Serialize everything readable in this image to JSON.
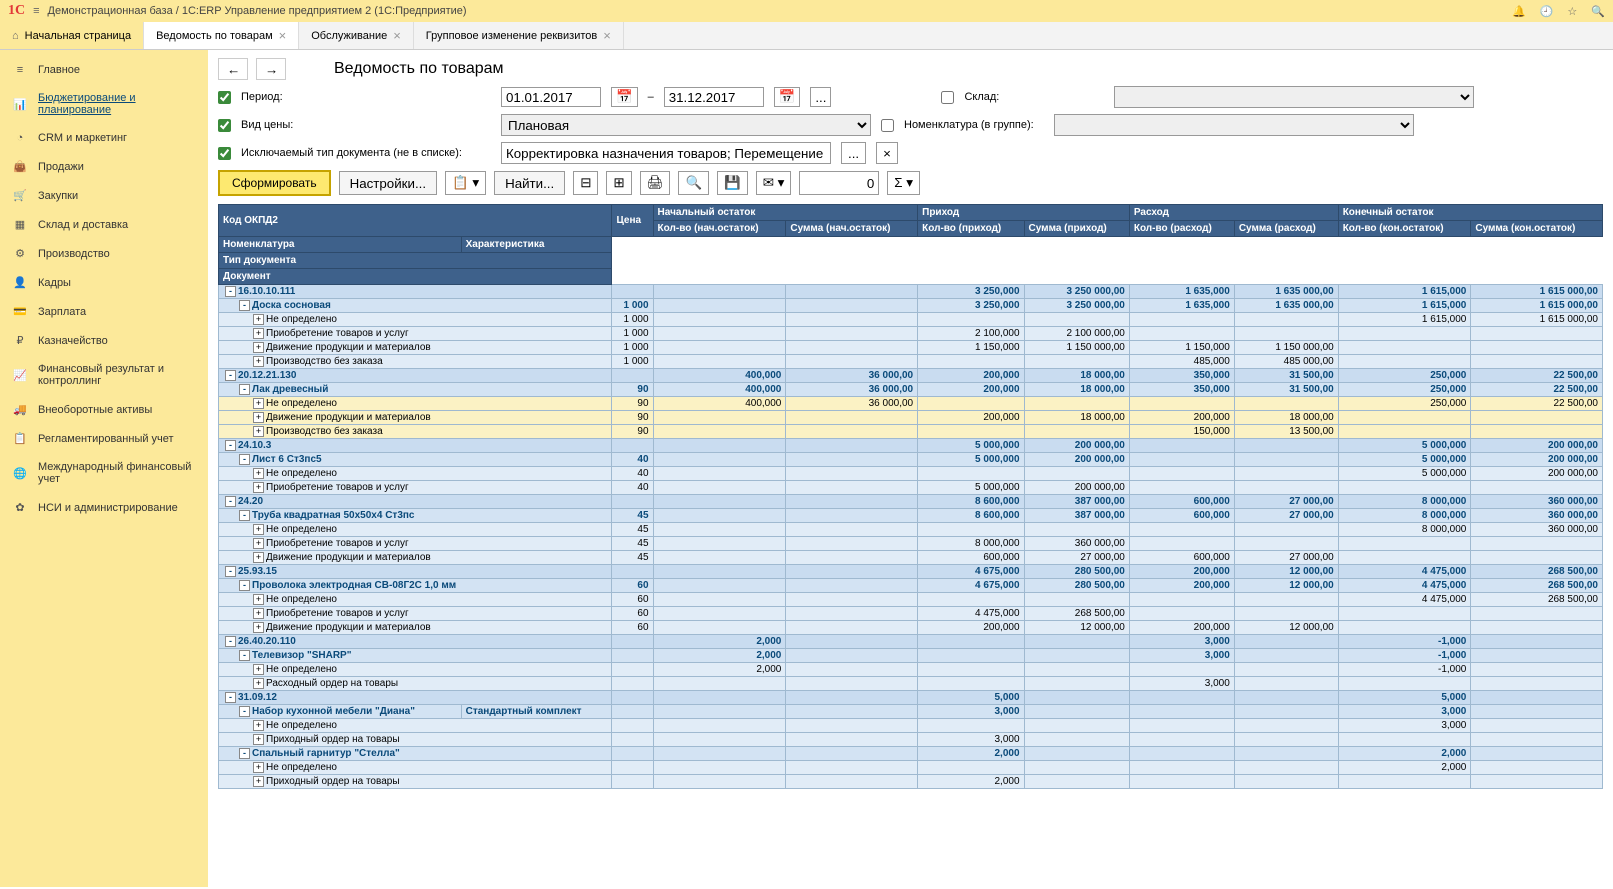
{
  "app": {
    "title": "Демонстрационная база / 1C:ERP Управление предприятием 2  (1С:Предприятие)"
  },
  "tabs": [
    {
      "label": "Начальная страница",
      "closeable": false
    },
    {
      "label": "Ведомость по товарам",
      "closeable": true,
      "active": true
    },
    {
      "label": "Обслуживание",
      "closeable": true
    },
    {
      "label": "Групповое изменение реквизитов",
      "closeable": true
    }
  ],
  "sidebar": [
    {
      "icon": "≡",
      "label": "Главное"
    },
    {
      "icon": "📊",
      "label": "Бюджетирование и планирование",
      "active": true
    },
    {
      "icon": "◔",
      "label": "CRM и маркетинг"
    },
    {
      "icon": "👜",
      "label": "Продажи"
    },
    {
      "icon": "🛒",
      "label": "Закупки"
    },
    {
      "icon": "▦",
      "label": "Склад и доставка"
    },
    {
      "icon": "⚙",
      "label": "Производство"
    },
    {
      "icon": "👤",
      "label": "Кадры"
    },
    {
      "icon": "💳",
      "label": "Зарплата"
    },
    {
      "icon": "₽",
      "label": "Казначейство"
    },
    {
      "icon": "📈",
      "label": "Финансовый результат и контроллинг"
    },
    {
      "icon": "🚚",
      "label": "Внеоборотные активы"
    },
    {
      "icon": "📋",
      "label": "Регламентированный учет"
    },
    {
      "icon": "🌐",
      "label": "Международный финансовый учет"
    },
    {
      "icon": "✿",
      "label": "НСИ и администрирование"
    }
  ],
  "page": {
    "title": "Ведомость по товарам"
  },
  "filters": {
    "period_label": "Период:",
    "date_from": "01.01.2017",
    "dash": "–",
    "date_to": "31.12.2017",
    "dots": "...",
    "warehouse_label": "Склад:",
    "pricetype_label": "Вид цены:",
    "pricetype_value": "Плановая",
    "nomenclature_label": "Номенклатура (в группе):",
    "excl_label": "Исключаемый тип документа (не в списке):",
    "excl_value": "Корректировка назначения товаров; Перемещение товаров"
  },
  "toolbar": {
    "form": "Сформировать",
    "settings": "Настройки...",
    "find": "Найти...",
    "number": "0"
  },
  "headers": {
    "okpd": "Код ОКПД2",
    "nom": "Номенклатура",
    "char": "Характеристика",
    "doctype": "Тип документа",
    "doc": "Документ",
    "price": "Цена",
    "start": "Начальный остаток",
    "qty_start": "Кол-во (нач.остаток)",
    "sum_start": "Сумма (нач.остаток)",
    "in": "Приход",
    "qty_in": "Кол-во (приход)",
    "sum_in": "Сумма (приход)",
    "out": "Расход",
    "qty_out": "Кол-во (расход)",
    "sum_out": "Сумма (расход)",
    "end": "Конечный остаток",
    "qty_end": "Кол-во (кон.остаток)",
    "sum_end": "Сумма (кон.остаток)"
  },
  "rows": [
    {
      "lvl": 0,
      "exp": "-",
      "name": "16.10.10.111",
      "qi": "3 250,000",
      "si": "3 250 000,00",
      "qo": "1 635,000",
      "so": "1 635 000,00",
      "qe": "1 615,000",
      "se": "1 615 000,00"
    },
    {
      "lvl": 1,
      "exp": "-",
      "name": "Доска сосновая",
      "price": "1 000",
      "qi": "3 250,000",
      "si": "3 250 000,00",
      "qo": "1 635,000",
      "so": "1 635 000,00",
      "qe": "1 615,000",
      "se": "1 615 000,00"
    },
    {
      "lvl": 2,
      "exp": "+",
      "name": "Не определено",
      "price": "1 000",
      "qe": "1 615,000",
      "se": "1 615 000,00"
    },
    {
      "lvl": 2,
      "exp": "+",
      "name": "Приобретение товаров и услуг",
      "price": "1 000",
      "qi": "2 100,000",
      "si": "2 100 000,00"
    },
    {
      "lvl": 2,
      "exp": "+",
      "name": "Движение продукции и материалов",
      "price": "1 000",
      "qi": "1 150,000",
      "si": "1 150 000,00",
      "qo": "1 150,000",
      "so": "1 150 000,00"
    },
    {
      "lvl": 2,
      "exp": "+",
      "name": "Производство без заказа",
      "price": "1 000",
      "qo": "485,000",
      "so": "485 000,00"
    },
    {
      "lvl": 0,
      "exp": "-",
      "name": "20.12.21.130",
      "qs": "400,000",
      "ss": "36 000,00",
      "qi": "200,000",
      "si": "18 000,00",
      "qo": "350,000",
      "so": "31 500,00",
      "qe": "250,000",
      "se": "22 500,00"
    },
    {
      "lvl": 1,
      "exp": "-",
      "name": "Лак древесный",
      "price": "90",
      "qs": "400,000",
      "ss": "36 000,00",
      "qi": "200,000",
      "si": "18 000,00",
      "qo": "350,000",
      "so": "31 500,00",
      "qe": "250,000",
      "se": "22 500,00"
    },
    {
      "lvl": 2,
      "exp": "+",
      "name": "Не определено",
      "price": "90",
      "qs": "400,000",
      "ss": "36 000,00",
      "qe": "250,000",
      "se": "22 500,00",
      "hl": true
    },
    {
      "lvl": 2,
      "exp": "+",
      "name": "Движение продукции и материалов",
      "price": "90",
      "qi": "200,000",
      "si": "18 000,00",
      "qo": "200,000",
      "so": "18 000,00",
      "hl": true
    },
    {
      "lvl": 2,
      "exp": "+",
      "name": "Производство без заказа",
      "price": "90",
      "qo": "150,000",
      "so": "13 500,00",
      "hl": true
    },
    {
      "lvl": 0,
      "exp": "-",
      "name": "24.10.3",
      "qi": "5 000,000",
      "si": "200 000,00",
      "qe": "5 000,000",
      "se": "200 000,00"
    },
    {
      "lvl": 1,
      "exp": "-",
      "name": "Лист 6 Ст3пс5",
      "price": "40",
      "qi": "5 000,000",
      "si": "200 000,00",
      "qe": "5 000,000",
      "se": "200 000,00"
    },
    {
      "lvl": 2,
      "exp": "+",
      "name": "Не определено",
      "price": "40",
      "qe": "5 000,000",
      "se": "200 000,00"
    },
    {
      "lvl": 2,
      "exp": "+",
      "name": "Приобретение товаров и услуг",
      "price": "40",
      "qi": "5 000,000",
      "si": "200 000,00"
    },
    {
      "lvl": 0,
      "exp": "-",
      "name": "24.20",
      "qi": "8 600,000",
      "si": "387 000,00",
      "qo": "600,000",
      "so": "27 000,00",
      "qe": "8 000,000",
      "se": "360 000,00"
    },
    {
      "lvl": 1,
      "exp": "-",
      "name": "Труба квадратная 50х50х4 Ст3пс",
      "price": "45",
      "qi": "8 600,000",
      "si": "387 000,00",
      "qo": "600,000",
      "so": "27 000,00",
      "qe": "8 000,000",
      "se": "360 000,00"
    },
    {
      "lvl": 2,
      "exp": "+",
      "name": "Не определено",
      "price": "45",
      "qe": "8 000,000",
      "se": "360 000,00"
    },
    {
      "lvl": 2,
      "exp": "+",
      "name": "Приобретение товаров и услуг",
      "price": "45",
      "qi": "8 000,000",
      "si": "360 000,00"
    },
    {
      "lvl": 2,
      "exp": "+",
      "name": "Движение продукции и материалов",
      "price": "45",
      "qi": "600,000",
      "si": "27 000,00",
      "qo": "600,000",
      "so": "27 000,00"
    },
    {
      "lvl": 0,
      "exp": "-",
      "name": "25.93.15",
      "qi": "4 675,000",
      "si": "280 500,00",
      "qo": "200,000",
      "so": "12 000,00",
      "qe": "4 475,000",
      "se": "268 500,00"
    },
    {
      "lvl": 1,
      "exp": "-",
      "name": "Проволока электродная СВ-08Г2С 1,0 мм",
      "price": "60",
      "qi": "4 675,000",
      "si": "280 500,00",
      "qo": "200,000",
      "so": "12 000,00",
      "qe": "4 475,000",
      "se": "268 500,00"
    },
    {
      "lvl": 2,
      "exp": "+",
      "name": "Не определено",
      "price": "60",
      "qe": "4 475,000",
      "se": "268 500,00"
    },
    {
      "lvl": 2,
      "exp": "+",
      "name": "Приобретение товаров и услуг",
      "price": "60",
      "qi": "4 475,000",
      "si": "268 500,00"
    },
    {
      "lvl": 2,
      "exp": "+",
      "name": "Движение продукции и материалов",
      "price": "60",
      "qi": "200,000",
      "si": "12 000,00",
      "qo": "200,000",
      "so": "12 000,00"
    },
    {
      "lvl": 0,
      "exp": "-",
      "name": "26.40.20.110",
      "qs": "2,000",
      "qo": "3,000",
      "qe": "-1,000"
    },
    {
      "lvl": 1,
      "exp": "-",
      "name": "Телевизор \"SHARP\"",
      "qs": "2,000",
      "qo": "3,000",
      "qe": "-1,000"
    },
    {
      "lvl": 2,
      "exp": "+",
      "name": "Не определено",
      "qs": "2,000",
      "qe": "-1,000"
    },
    {
      "lvl": 2,
      "exp": "+",
      "name": "Расходный ордер на товары",
      "qo": "3,000"
    },
    {
      "lvl": 0,
      "exp": "-",
      "name": "31.09.12",
      "qi": "5,000",
      "qe": "5,000"
    },
    {
      "lvl": 1,
      "exp": "-",
      "name": "Набор кухонной мебели \"Диана\"",
      "char": "Стандартный комплект",
      "qi": "3,000",
      "qe": "3,000"
    },
    {
      "lvl": 2,
      "exp": "+",
      "name": "Не определено",
      "qe": "3,000"
    },
    {
      "lvl": 2,
      "exp": "+",
      "name": "Приходный ордер на товары",
      "qi": "3,000"
    },
    {
      "lvl": 1,
      "exp": "-",
      "name": "Спальный гарнитур \"Стелла\"",
      "qi": "2,000",
      "qe": "2,000"
    },
    {
      "lvl": 2,
      "exp": "+",
      "name": "Не определено",
      "qe": "2,000"
    },
    {
      "lvl": 2,
      "exp": "+",
      "name": "Приходный ордер на товары",
      "qi": "2,000"
    }
  ]
}
